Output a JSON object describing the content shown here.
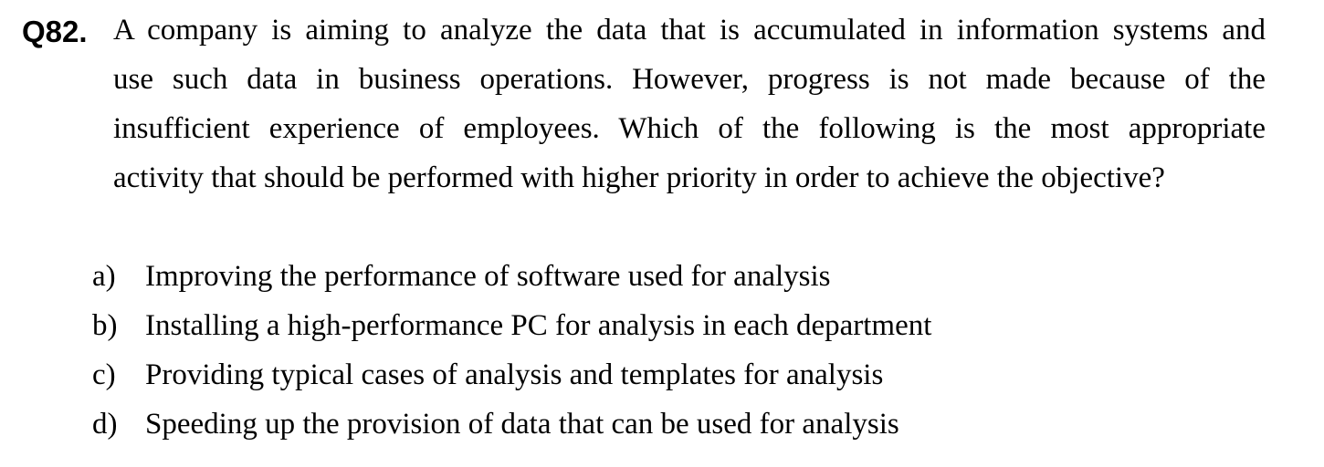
{
  "question": {
    "number": "Q82.",
    "lines": [
      "A company is aiming to analyze the data that is accumulated in information systems and",
      "use such data in business operations.   However, progress is not made because of the",
      "insufficient experience of employees.   Which of the following is the most appropriate",
      "activity that should be performed with higher priority in order to achieve the objective?"
    ]
  },
  "options": [
    {
      "letter": "a)",
      "text": "Improving the performance of software used for analysis"
    },
    {
      "letter": "b)",
      "text": "Installing a high-performance PC for analysis in each department"
    },
    {
      "letter": "c)",
      "text": "Providing typical cases of analysis and templates for analysis"
    },
    {
      "letter": "d)",
      "text": "Speeding up the provision of data that can be used for analysis"
    }
  ]
}
